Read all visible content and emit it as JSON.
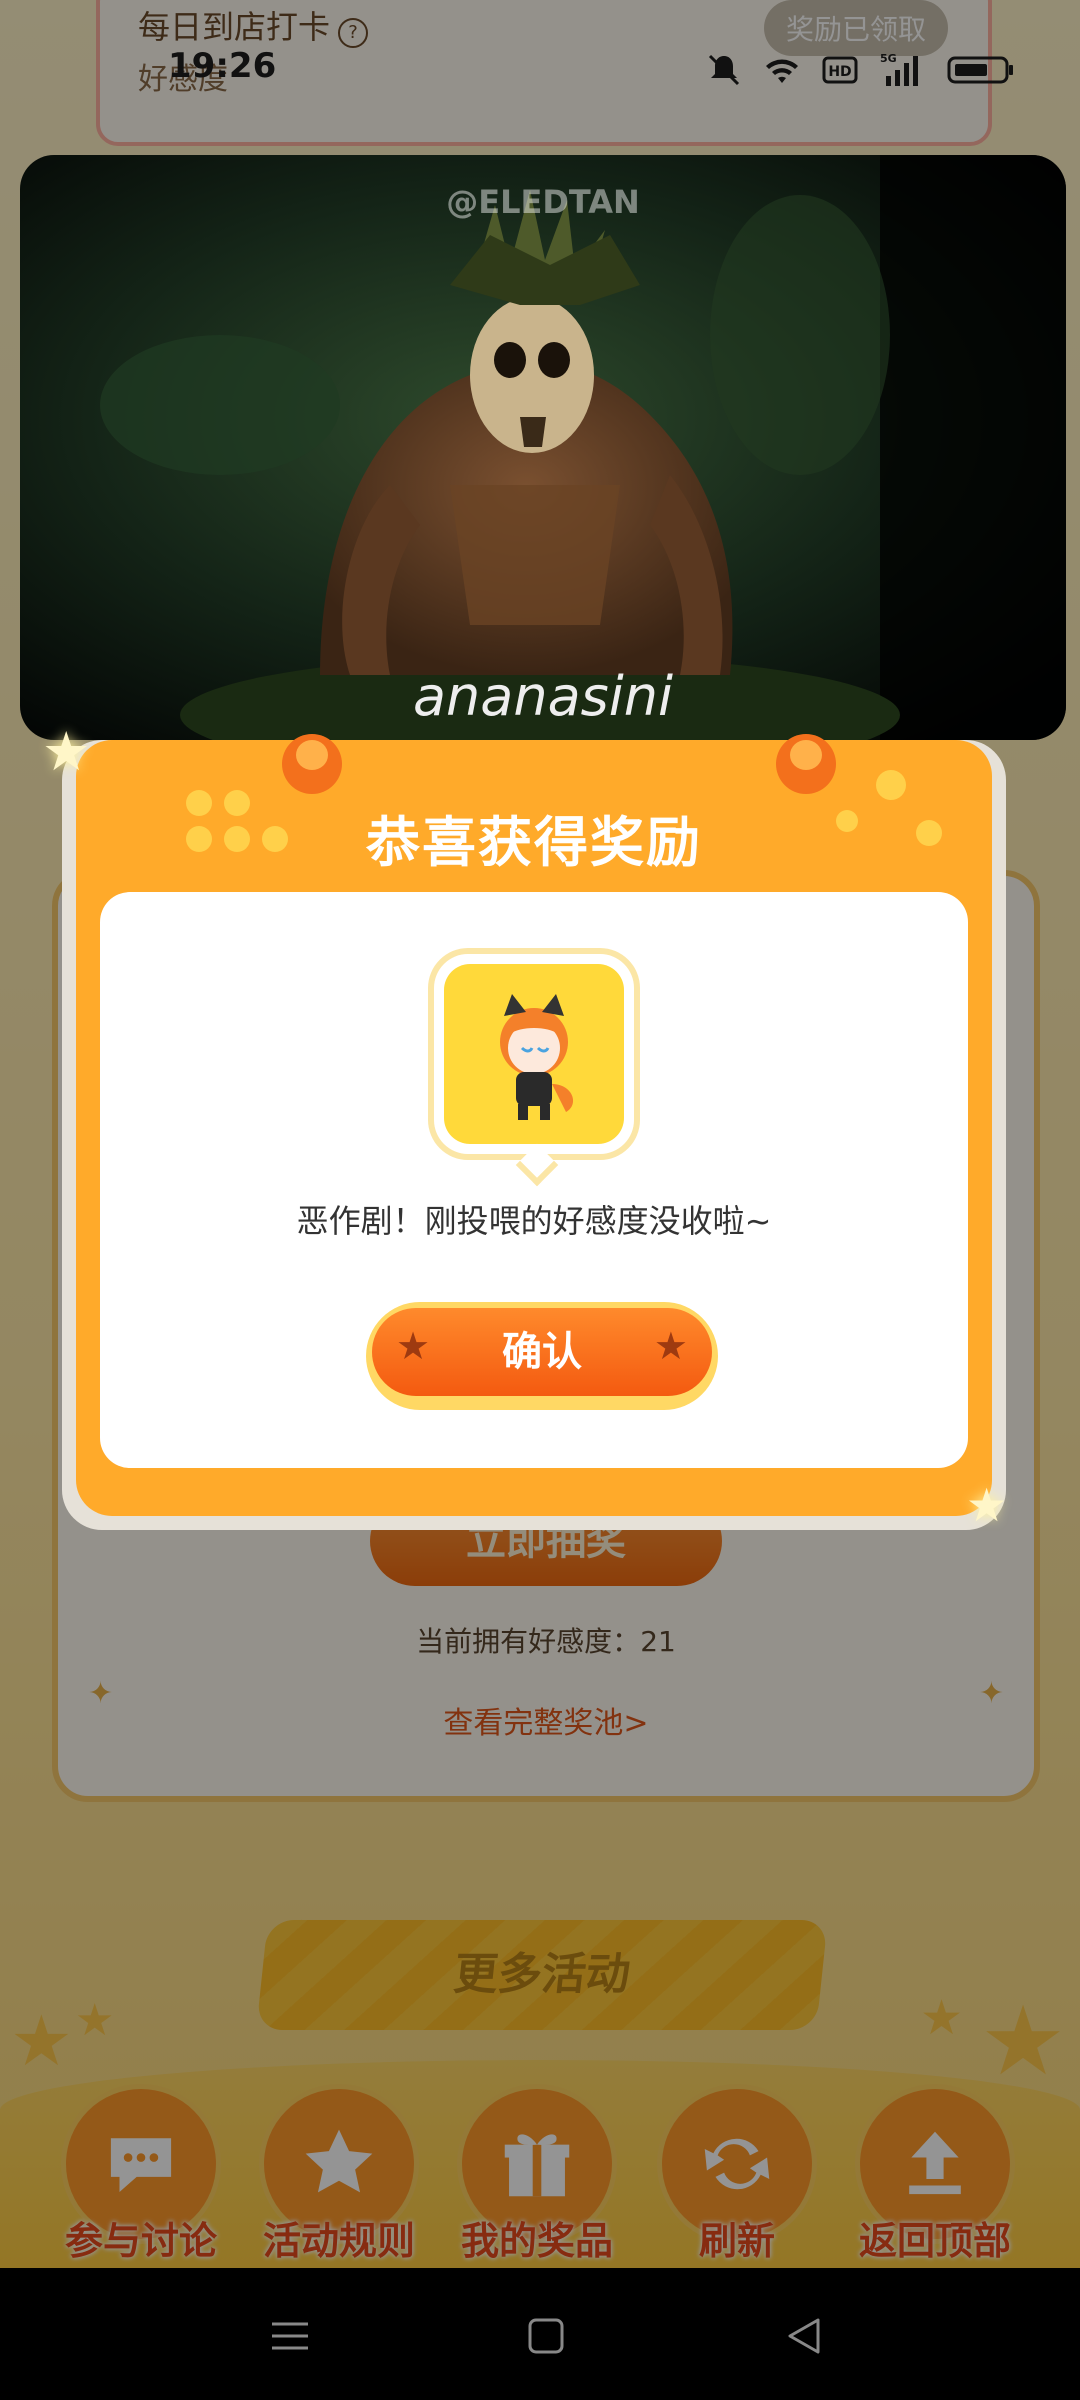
{
  "status_bar": {
    "time": "19:26",
    "network": "5G"
  },
  "checkin": {
    "title": "每日到店打卡",
    "help_icon": "?",
    "subtitle": "好感度",
    "status": "奖励已领取"
  },
  "video": {
    "watermark_top": "@ELEDTAN",
    "caption": "ananasini"
  },
  "dialog": {
    "title": "恭喜获得奖励",
    "message": "恶作剧！刚投喂的好感度没收啦~",
    "confirm_label": "确认"
  },
  "draw_card": {
    "draw_button": "立即抽奖",
    "affection_label": "当前拥有好感度：",
    "affection_value": "21",
    "pool_link": "查看完整奖池>"
  },
  "more_activities": "更多活动",
  "bottom_nav": [
    {
      "label": "参与讨论",
      "icon": "chat-icon"
    },
    {
      "label": "活动规则",
      "icon": "star-icon"
    },
    {
      "label": "我的奖品",
      "icon": "gift-icon"
    },
    {
      "label": "刷新",
      "icon": "refresh-icon"
    },
    {
      "label": "返回顶部",
      "icon": "upload-icon"
    }
  ],
  "system_nav": [
    "menu-icon",
    "home-icon",
    "back-icon"
  ],
  "colors": {
    "accent_orange": "#f45a10",
    "dialog_orange": "#ffaa2a",
    "nav_label": "#e84a1c"
  }
}
